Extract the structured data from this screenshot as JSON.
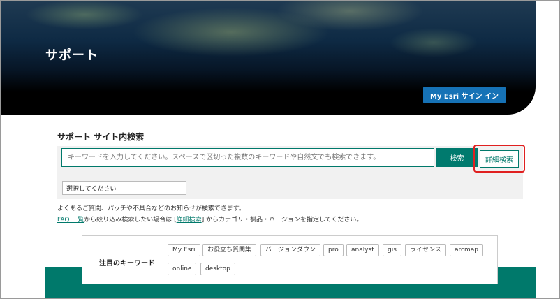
{
  "hero": {
    "title": "サポート",
    "signin_label": "My Esri サイン イン"
  },
  "search": {
    "section_title": "サポート サイト内検索",
    "placeholder": "キーワードを入力してください。スペースで区切った複数のキーワードや自然文でも検索できます。",
    "search_label": "検索",
    "advanced_label": "詳細検索",
    "select_value": "選択してください",
    "note1": "よくあるご質問、パッチや不具合などのお知らせが検索できます。",
    "note2_link1": "FAQ 一覧",
    "note2_mid": "から絞り込み検索したい場合は [",
    "note2_link2": "詳細検索",
    "note2_end": "] からカテゴリ・製品・バージョンを指定してください。"
  },
  "keywords": {
    "title": "注目のキーワード",
    "tags": [
      "My Esri",
      "お役立ち質問集",
      "バージョンダウン",
      "pro",
      "analyst",
      "gis",
      "ライセンス",
      "arcmap",
      "online",
      "desktop"
    ]
  },
  "colors": {
    "accent": "#007a6e",
    "signin": "#1672b6",
    "highlight": "#e02020"
  }
}
